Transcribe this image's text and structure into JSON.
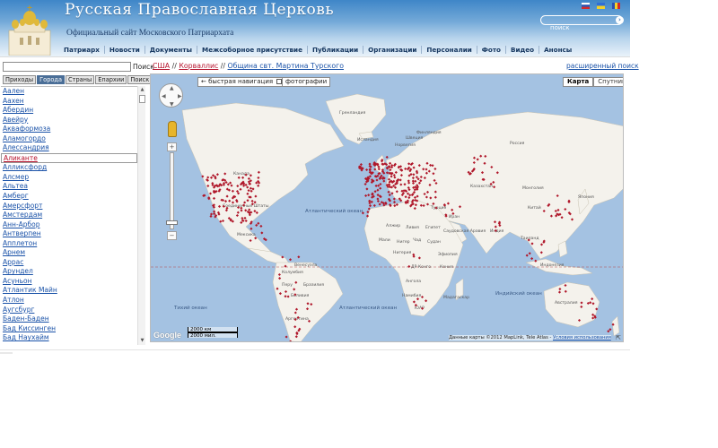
{
  "header": {
    "title": "Русская Православная Церковь",
    "subtitle": "Официальный сайт Московского Патриархата",
    "search_placeholder": "поиск",
    "brand_color": "#3f86c8"
  },
  "topnav": [
    "Патриарх",
    "Новости",
    "Документы",
    "Межсоборное присутствие",
    "Публикации",
    "Организации",
    "Персоналии",
    "Фото",
    "Видео",
    "Анонсы"
  ],
  "left": {
    "search_button": "Поиск",
    "tabs": [
      "Приходы",
      "Города",
      "Страны",
      "Епархии",
      "Поиск"
    ],
    "active_tab": "Города",
    "cities": [
      "Аален",
      "Аахен",
      "Абердин",
      "Авейру",
      "Акваформоза",
      "Аламогордо",
      "Алессандрия",
      "Аликанте",
      "Алликсфорд",
      "Алсмер",
      "Альтеа",
      "Амберг",
      "Амерсфорт",
      "Амстердам",
      "Анн-Арбор",
      "Антверпен",
      "Апплетон",
      "Арнем",
      "Аррас",
      "Арундел",
      "Асуньон",
      "Атлантик Майн",
      "Атлон",
      "Аугсбург",
      "Баден-Баден",
      "Бад Киссинген",
      "Бад Наухайм"
    ],
    "selected_city": "Аликанте"
  },
  "breadcrumb": {
    "items": [
      "США",
      "Корваллис",
      "Община свт. Мартина Турского"
    ],
    "separator": "//"
  },
  "advanced_search": "расширенный поиск",
  "map": {
    "quick_nav": "быстрая навигация",
    "photos": "фотографии",
    "type_map": "Карта",
    "type_satellite": "Спутник",
    "scale_km": "2000 км",
    "scale_mi": "2000 мил.",
    "attribution": "Данные карты ©2012 MapLink, Tele Atlas -",
    "terms": "Условия использования",
    "logo": "Google",
    "ocean_labels": {
      "atlantic": "Атлантический океан",
      "pacific": "Тихий океан",
      "pacific2": "Тихий океан",
      "indian": "Индийский океан"
    },
    "country_labels": {
      "greenland": "Гренландия",
      "russia": "Россия",
      "china": "Китай",
      "kazakhstan": "Казахстан",
      "mongolia": "Монголия",
      "iran": "Иран",
      "india": "Индия",
      "algeria": "Алжир",
      "libya": "Ливия",
      "egypt": "Египет",
      "mali": "Мали",
      "niger": "Нигер",
      "chad": "Чад",
      "sudan": "Судан",
      "nigeria": "Нигерия",
      "ethiopia": "Эфиопия",
      "drc": "ДР Конго",
      "angola": "Ангола",
      "namibia": "Намибия",
      "south_africa": "ЮАР",
      "madagascar": "Мадагаскар",
      "kenya": "Кения",
      "brazil": "Бразилия",
      "peru": "Перу",
      "bolivia": "Боливия",
      "venezuela": "Венесуэла",
      "colombia": "Колумбия",
      "argentina": "Аргентина",
      "mexico": "Мексика",
      "canada": "Канада",
      "usa": "Соединенные Штаты",
      "turkey": "Турция",
      "saudi": "Саудовская Аравия",
      "indonesia": "Индонезия",
      "australia": "Австралия",
      "japan": "Япония",
      "thailand": "Таиланд",
      "norway": "Норвегия",
      "sweden": "Швеция",
      "finland": "Финляндия",
      "iceland": "Исландия"
    }
  }
}
